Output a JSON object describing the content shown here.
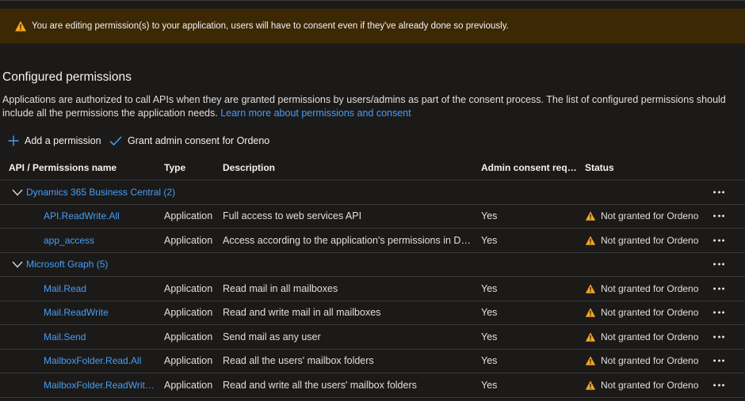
{
  "banner": {
    "text": "You are editing permission(s) to your application, users will have to consent even if they've already done so previously."
  },
  "section": {
    "title": "Configured permissions",
    "description": "Applications are authorized to call APIs when they are granted permissions by users/admins as part of the consent process. The list of configured permissions should include all the permissions the application needs.",
    "learn_more": "Learn more about permissions and consent"
  },
  "commands": {
    "add_permission": "Add a permission",
    "grant_consent": "Grant admin consent for Ordeno"
  },
  "columns": {
    "name": "API / Permissions name",
    "type": "Type",
    "description": "Description",
    "admin": "Admin consent requ...",
    "status": "Status"
  },
  "groups": [
    {
      "label": "Dynamics 365 Business Central (2)",
      "permissions": [
        {
          "name": "API.ReadWrite.All",
          "type": "Application",
          "description": "Full access to web services API",
          "admin": "Yes",
          "status": "Not granted for Ordeno"
        },
        {
          "name": "app_access",
          "type": "Application",
          "description": "Access according to the application's permissions in Dyna...",
          "admin": "Yes",
          "status": "Not granted for Ordeno"
        }
      ]
    },
    {
      "label": "Microsoft Graph (5)",
      "permissions": [
        {
          "name": "Mail.Read",
          "type": "Application",
          "description": "Read mail in all mailboxes",
          "admin": "Yes",
          "status": "Not granted for Ordeno"
        },
        {
          "name": "Mail.ReadWrite",
          "type": "Application",
          "description": "Read and write mail in all mailboxes",
          "admin": "Yes",
          "status": "Not granted for Ordeno"
        },
        {
          "name": "Mail.Send",
          "type": "Application",
          "description": "Send mail as any user",
          "admin": "Yes",
          "status": "Not granted for Ordeno"
        },
        {
          "name": "MailboxFolder.Read.All",
          "type": "Application",
          "description": "Read all the users' mailbox folders",
          "admin": "Yes",
          "status": "Not granted for Ordeno"
        },
        {
          "name": "MailboxFolder.ReadWrite.All",
          "type": "Application",
          "description": "Read and write all the users' mailbox folders",
          "admin": "Yes",
          "status": "Not granted for Ordeno"
        }
      ]
    }
  ],
  "icons": {
    "banner": "warning-icon",
    "add": "plus-icon",
    "grant": "checkmark-icon",
    "group_toggle": "chevron-down-icon",
    "status": "warning-icon",
    "row_menu": "more-icon"
  },
  "colors": {
    "background": "#1b1a19",
    "banner_bg": "#3d2805",
    "warning": "#f7a520",
    "link": "#479ef5"
  }
}
